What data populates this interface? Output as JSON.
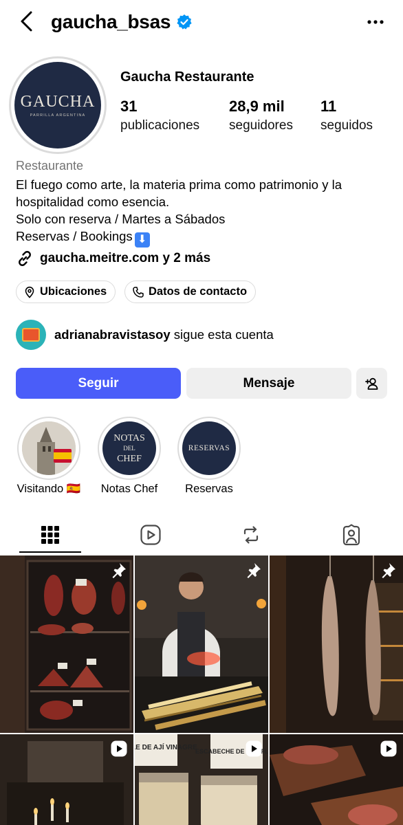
{
  "header": {
    "username": "gaucha_bsas"
  },
  "profile": {
    "avatar_name": "GAUCHA",
    "avatar_sub": "PARRILLA ARGENTINA",
    "display_name": "Gaucha Restaurante",
    "stats": [
      {
        "num": "31",
        "label": "publicaciones"
      },
      {
        "num": "28,9 mil",
        "label": "seguidores"
      },
      {
        "num": "11",
        "label": "seguidos"
      }
    ],
    "category": "Restaurante",
    "bio": [
      "El fuego como arte, la materia prima como patrimonio y la",
      "hospitalidad como esencia.",
      "Solo con reserva / Martes a Sábados",
      "Reservas / Bookings"
    ],
    "bio_emoji": "⬇",
    "link": "gaucha.meitre.com y 2 más"
  },
  "pills": {
    "locations": "Ubicaciones",
    "contact": "Datos de contacto"
  },
  "followed_by": {
    "user": "adrianabravistasoy",
    "suffix": " sigue esta cuenta"
  },
  "actions": {
    "follow": "Seguir",
    "message": "Mensaje"
  },
  "highlights": [
    {
      "label": "Visitando 🇪🇸"
    },
    {
      "label": "Notas Chef",
      "cover_lines": [
        "NOTAS",
        "DEL",
        "CHEF"
      ]
    },
    {
      "label": "Reservas",
      "cover_text": "RESERVAS"
    }
  ],
  "grid_items": [
    {
      "badge": "pin-icon"
    },
    {
      "badge": "pin-icon"
    },
    {
      "badge": "pin-icon"
    },
    {
      "badge": "reel-icon"
    },
    {
      "badge": "reel-icon"
    },
    {
      "badge": "reel-icon"
    }
  ],
  "grid_texts": {
    "jar_label_1": "PICKLE DE AJÍ VINAGRE",
    "jar_label_2": "ESCABECHE DE COLIFLOR"
  },
  "colors": {
    "follow_blue": "#4a5df9",
    "verified_blue": "#0095f6",
    "brand_navy": "#1f2a44"
  }
}
